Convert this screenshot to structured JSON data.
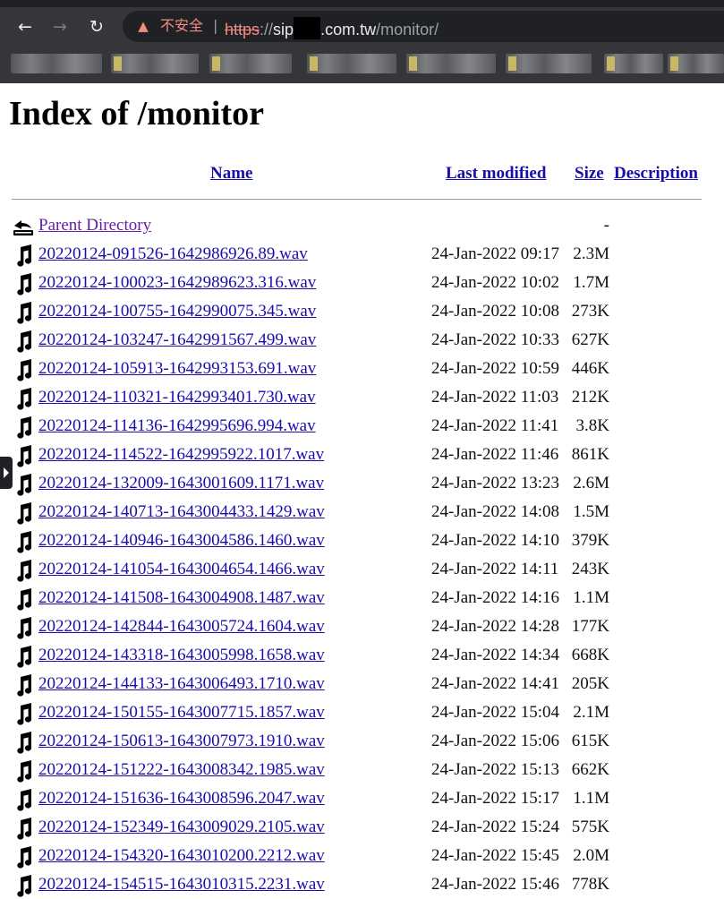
{
  "browser": {
    "security_label": "不安全",
    "url_scheme": "https",
    "url_sep": "://",
    "url_host_start": "sip",
    "url_host_end": ".com.tw",
    "url_path": "/monitor/",
    "nav_icons": [
      "back-arrow-icon",
      "forward-arrow-icon",
      "reload-icon"
    ]
  },
  "page": {
    "title": "Index of /monitor",
    "columns": [
      "Name",
      "Last modified",
      "Size",
      "Description"
    ]
  },
  "parent": {
    "label": "Parent Directory",
    "size": "-"
  },
  "files": [
    {
      "name": "20220124-091526-1642986926.89.wav",
      "modified": "24-Jan-2022 09:17",
      "size": "2.3M"
    },
    {
      "name": "20220124-100023-1642989623.316.wav",
      "modified": "24-Jan-2022 10:02",
      "size": "1.7M"
    },
    {
      "name": "20220124-100755-1642990075.345.wav",
      "modified": "24-Jan-2022 10:08",
      "size": "273K"
    },
    {
      "name": "20220124-103247-1642991567.499.wav",
      "modified": "24-Jan-2022 10:33",
      "size": "627K"
    },
    {
      "name": "20220124-105913-1642993153.691.wav",
      "modified": "24-Jan-2022 10:59",
      "size": "446K"
    },
    {
      "name": "20220124-110321-1642993401.730.wav",
      "modified": "24-Jan-2022 11:03",
      "size": "212K"
    },
    {
      "name": "20220124-114136-1642995696.994.wav",
      "modified": "24-Jan-2022 11:41",
      "size": "3.8K"
    },
    {
      "name": "20220124-114522-1642995922.1017.wav",
      "modified": "24-Jan-2022 11:46",
      "size": "861K"
    },
    {
      "name": "20220124-132009-1643001609.1171.wav",
      "modified": "24-Jan-2022 13:23",
      "size": "2.6M"
    },
    {
      "name": "20220124-140713-1643004433.1429.wav",
      "modified": "24-Jan-2022 14:08",
      "size": "1.5M"
    },
    {
      "name": "20220124-140946-1643004586.1460.wav",
      "modified": "24-Jan-2022 14:10",
      "size": "379K"
    },
    {
      "name": "20220124-141054-1643004654.1466.wav",
      "modified": "24-Jan-2022 14:11",
      "size": "243K"
    },
    {
      "name": "20220124-141508-1643004908.1487.wav",
      "modified": "24-Jan-2022 14:16",
      "size": "1.1M"
    },
    {
      "name": "20220124-142844-1643005724.1604.wav",
      "modified": "24-Jan-2022 14:28",
      "size": "177K"
    },
    {
      "name": "20220124-143318-1643005998.1658.wav",
      "modified": "24-Jan-2022 14:34",
      "size": "668K"
    },
    {
      "name": "20220124-144133-1643006493.1710.wav",
      "modified": "24-Jan-2022 14:41",
      "size": "205K"
    },
    {
      "name": "20220124-150155-1643007715.1857.wav",
      "modified": "24-Jan-2022 15:04",
      "size": "2.1M"
    },
    {
      "name": "20220124-150613-1643007973.1910.wav",
      "modified": "24-Jan-2022 15:06",
      "size": "615K"
    },
    {
      "name": "20220124-151222-1643008342.1985.wav",
      "modified": "24-Jan-2022 15:13",
      "size": "662K"
    },
    {
      "name": "20220124-151636-1643008596.2047.wav",
      "modified": "24-Jan-2022 15:17",
      "size": "1.1M"
    },
    {
      "name": "20220124-152349-1643009029.2105.wav",
      "modified": "24-Jan-2022 15:24",
      "size": "575K"
    },
    {
      "name": "20220124-154320-1643010200.2212.wav",
      "modified": "24-Jan-2022 15:45",
      "size": "2.0M"
    },
    {
      "name": "20220124-154515-1643010315.2231.wav",
      "modified": "24-Jan-2022 15:46",
      "size": "778K"
    }
  ],
  "colors": {
    "link": "#1a0dab",
    "visited": "#681da8",
    "chrome": "#35363a",
    "warning": "#f28b82"
  }
}
